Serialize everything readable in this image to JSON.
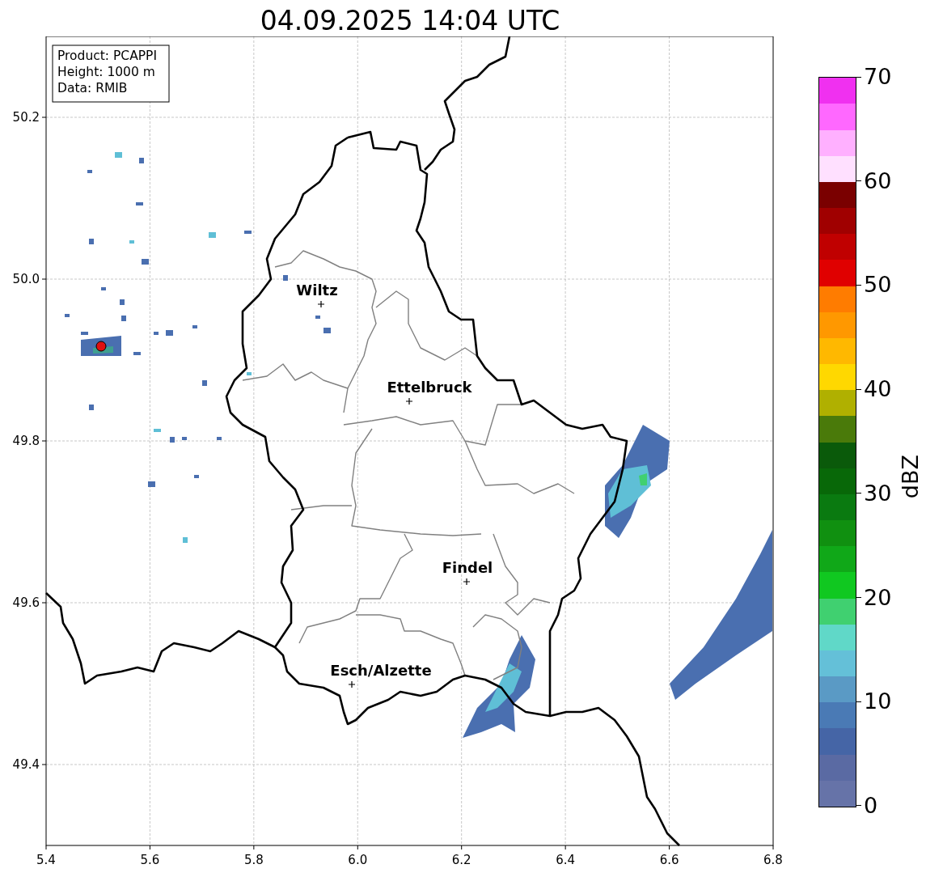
{
  "title": "04.09.2025 14:04 UTC",
  "info_box": [
    "Product: PCAPPI",
    "Height: 1000 m",
    "Data: RMIB"
  ],
  "x_ticks": [
    "5.4",
    "5.6",
    "5.8",
    "6.0",
    "6.2",
    "6.4",
    "6.6",
    "6.8"
  ],
  "y_ticks": [
    "50.2",
    "50.0",
    "49.8",
    "49.6",
    "49.4"
  ],
  "cities": [
    {
      "name": "Wiltz"
    },
    {
      "name": "Ettelbruck"
    },
    {
      "name": "Findel"
    },
    {
      "name": "Esch/Alzette"
    }
  ],
  "colorbar": {
    "label": "dBZ",
    "ticks": [
      "70",
      "60",
      "50",
      "40",
      "30",
      "20",
      "10",
      "0"
    ],
    "steps": [
      {
        "color": "#6673a8"
      },
      {
        "color": "#5a6aa3"
      },
      {
        "color": "#4565a6"
      },
      {
        "color": "#4a7ab5"
      },
      {
        "color": "#5a9ac5"
      },
      {
        "color": "#64c0d8"
      },
      {
        "color": "#60d8c8"
      },
      {
        "color": "#40d070"
      },
      {
        "color": "#10c820"
      },
      {
        "color": "#10a818"
      },
      {
        "color": "#109010"
      },
      {
        "color": "#0a7a10"
      },
      {
        "color": "#086808"
      },
      {
        "color": "#0a5a0a"
      },
      {
        "color": "#4a7a0a"
      },
      {
        "color": "#b0b000"
      },
      {
        "color": "#ffd800"
      },
      {
        "color": "#ffb800"
      },
      {
        "color": "#ff9800"
      },
      {
        "color": "#ff7c00"
      },
      {
        "color": "#e00000"
      },
      {
        "color": "#c00000"
      },
      {
        "color": "#a00000"
      },
      {
        "color": "#7a0000"
      },
      {
        "color": "#ffe0ff"
      },
      {
        "color": "#ffb0ff"
      },
      {
        "color": "#ff68ff"
      },
      {
        "color": "#f030f0"
      }
    ]
  }
}
